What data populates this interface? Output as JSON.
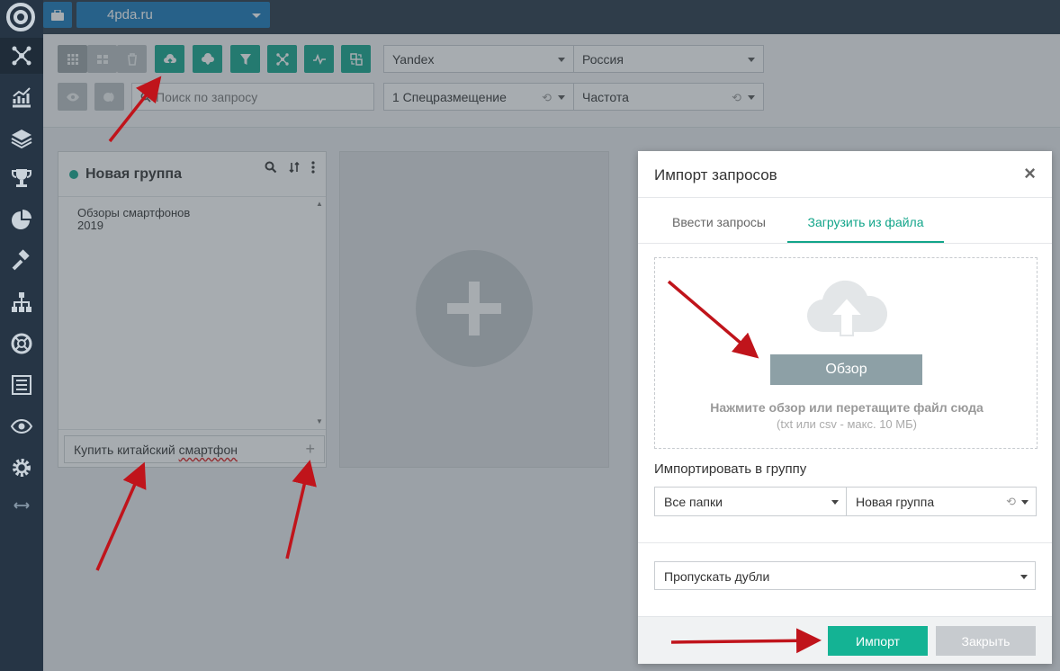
{
  "topbar": {
    "project": "4pda.ru"
  },
  "sidebar": {
    "items": [
      "network-icon",
      "chart-icon",
      "layers-icon",
      "trophy-icon",
      "pie-icon",
      "gavel-icon",
      "sitemap-icon",
      "lifebuoy-icon",
      "report-icon",
      "eye-icon",
      "gear-icon",
      "expand-icon"
    ]
  },
  "toolbar": {
    "search_placeholder": "Поиск по запросу",
    "engine": "Yandex",
    "region": "Россия",
    "position": "1 Спецразмещение",
    "frequency": "Частота"
  },
  "group": {
    "title": "Новая группа",
    "keyword_line1": "Обзоры смартфонов",
    "keyword_line2": "2019",
    "add_value": "Купить китайский ",
    "add_value_misspelled": "смартфон",
    "add_symbol": "+"
  },
  "modal": {
    "title": "Импорт запросов",
    "close_symbol": "×",
    "tab_enter": "Ввести запросы",
    "tab_upload": "Загрузить из файла",
    "browse_label": "Обзор",
    "drop_hint": "Нажмите обзор или перетащите файл сюда",
    "drop_sub": "(txt или csv - макс. 10 МБ)",
    "import_to_group_label": "Импортировать в группу",
    "folder_select": "Все папки",
    "group_select": "Новая группа",
    "duplicates_select": "Пропускать дубли",
    "import_button": "Импорт",
    "close_button": "Закрыть"
  },
  "colors": {
    "accent": "#12a58a",
    "brand_blue": "#1677b8",
    "sidebar": "#263545",
    "arrow": "#c0141b"
  }
}
